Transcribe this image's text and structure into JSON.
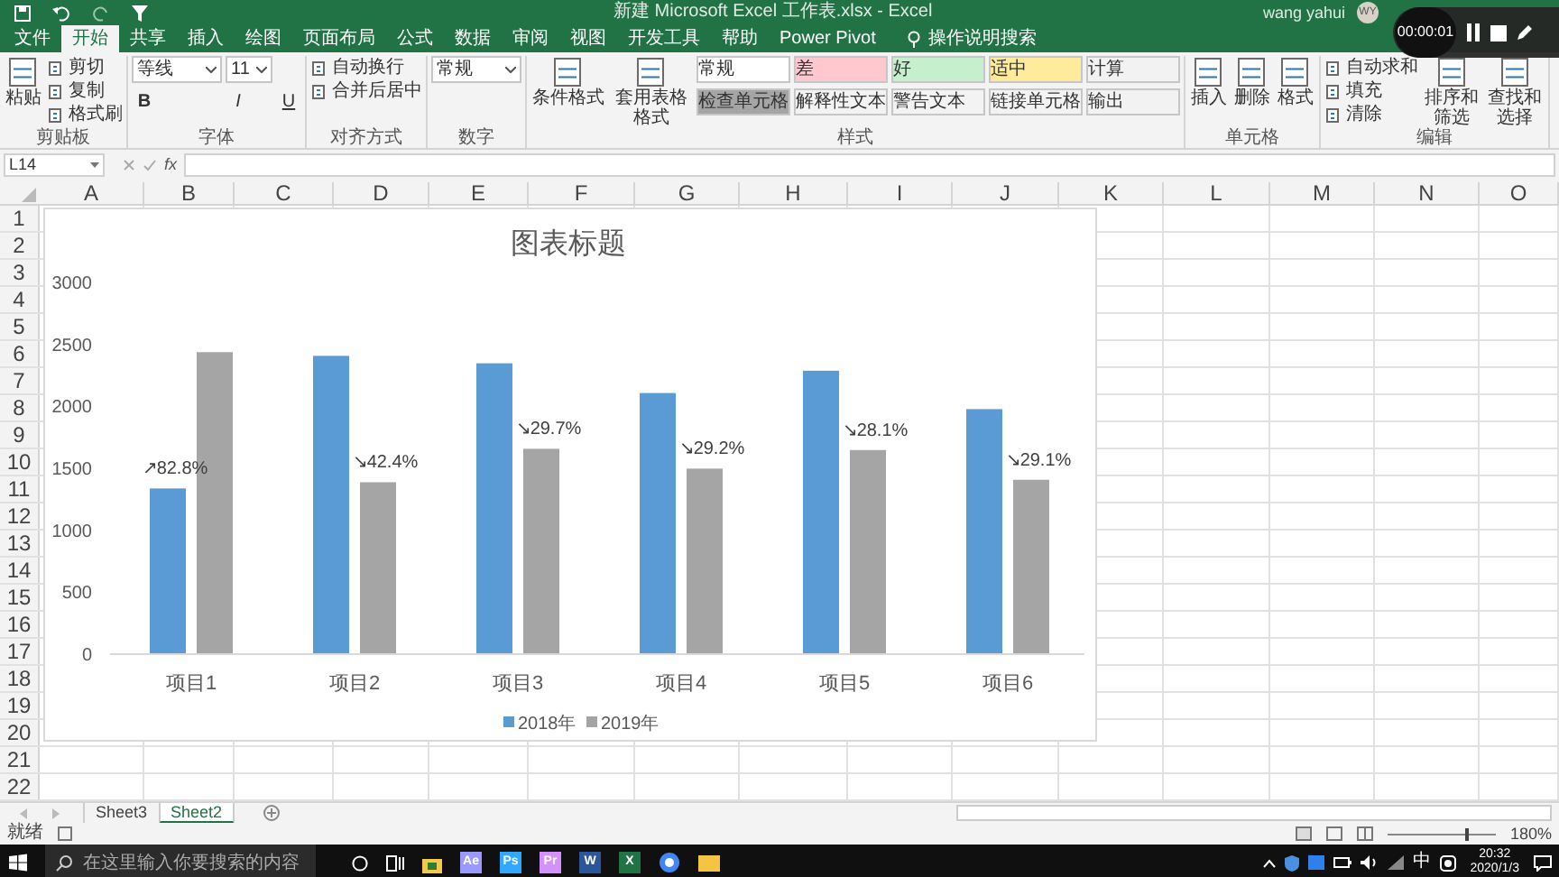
{
  "window": {
    "title": "新建 Microsoft Excel 工作表.xlsx - Excel",
    "user": "wang yahui",
    "avatar": "WY"
  },
  "recorder": {
    "time": "00:00:01"
  },
  "ribbon_tabs": [
    {
      "label": "文件",
      "selected": false
    },
    {
      "label": "开始",
      "selected": true
    },
    {
      "label": "共享",
      "selected": false
    },
    {
      "label": "插入",
      "selected": false
    },
    {
      "label": "绘图",
      "selected": false
    },
    {
      "label": "页面布局",
      "selected": false
    },
    {
      "label": "公式",
      "selected": false
    },
    {
      "label": "数据",
      "selected": false
    },
    {
      "label": "审阅",
      "selected": false
    },
    {
      "label": "视图",
      "selected": false
    },
    {
      "label": "开发工具",
      "selected": false
    },
    {
      "label": "帮助",
      "selected": false
    },
    {
      "label": "Power Pivot",
      "selected": false
    }
  ],
  "tell_me": "操作说明搜索",
  "ribbon_groups": [
    {
      "label": "剪贴板",
      "columns": [
        [
          {
            "kind": "big",
            "label": "粘贴"
          }
        ],
        [
          {
            "kind": "small",
            "label": "剪切"
          },
          {
            "kind": "small",
            "label": "复制"
          },
          {
            "kind": "small",
            "label": "格式刷"
          }
        ]
      ]
    },
    {
      "label": "字体",
      "columns": [
        [
          {
            "kind": "field",
            "value": "等线"
          },
          {
            "kind": "glyph",
            "label": "B"
          }
        ],
        [
          {
            "kind": "spin",
            "value": "11"
          },
          {
            "kind": "glyph",
            "label": "I"
          }
        ],
        [
          {
            "kind": "glyph",
            "label": "U"
          }
        ]
      ]
    },
    {
      "label": "对齐方式",
      "columns": [
        [
          {
            "kind": "small",
            "label": "自动换行"
          },
          {
            "kind": "small",
            "label": "合并后居中"
          }
        ]
      ]
    },
    {
      "label": "数字",
      "columns": [
        [
          {
            "kind": "field",
            "value": "常规"
          }
        ]
      ]
    },
    {
      "label": "样式",
      "columns": [
        [
          {
            "kind": "big",
            "label": "条件格式"
          }
        ],
        [
          {
            "kind": "big",
            "label": "套用表格格式"
          }
        ],
        [
          {
            "kind": "style",
            "label": "常规",
            "color": "#ffffff"
          },
          {
            "kind": "style",
            "label": "检查单元格",
            "color": "#a5a5a5"
          }
        ],
        [
          {
            "kind": "style",
            "label": "差",
            "color": "#ffc7ce"
          },
          {
            "kind": "style",
            "label": "解释性文本",
            "color": "#f3f3f3"
          }
        ],
        [
          {
            "kind": "style",
            "label": "好",
            "color": "#c6efce"
          },
          {
            "kind": "style",
            "label": "警告文本",
            "color": "#f3f3f3"
          }
        ],
        [
          {
            "kind": "style",
            "label": "适中",
            "color": "#ffeb9c"
          },
          {
            "kind": "style",
            "label": "链接单元格",
            "color": "#f3f3f3"
          }
        ],
        [
          {
            "kind": "style",
            "label": "计算",
            "color": "#f2f2f2"
          },
          {
            "kind": "style",
            "label": "输出",
            "color": "#f2f2f2"
          }
        ]
      ]
    },
    {
      "label": "单元格",
      "columns": [
        [
          {
            "kind": "big",
            "label": "插入"
          }
        ],
        [
          {
            "kind": "big",
            "label": "删除"
          }
        ],
        [
          {
            "kind": "big",
            "label": "格式"
          }
        ]
      ]
    },
    {
      "label": "编辑",
      "columns": [
        [
          {
            "kind": "small",
            "label": "自动求和"
          },
          {
            "kind": "small",
            "label": "填充"
          },
          {
            "kind": "small",
            "label": "清除"
          }
        ],
        [
          {
            "kind": "big",
            "label": "排序和筛选"
          }
        ],
        [
          {
            "kind": "big",
            "label": "查找和选择"
          }
        ]
      ]
    }
  ],
  "formula_bar": {
    "name_box": "L14",
    "function_label": "fx"
  },
  "columns": [
    "A",
    "B",
    "C",
    "D",
    "E",
    "F",
    "G",
    "H",
    "I",
    "J",
    "K",
    "L",
    "M",
    "N",
    "O"
  ],
  "rows": [
    "1",
    "2",
    "3",
    "4",
    "5",
    "6",
    "7",
    "8",
    "9",
    "10",
    "11",
    "12",
    "13",
    "14",
    "15",
    "16",
    "17",
    "18",
    "19",
    "20",
    "21",
    "22"
  ],
  "chart": {
    "chart_data": {
      "type": "bar",
      "title": "图表标题",
      "categories": [
        "项目1",
        "项目2",
        "项目3",
        "项目4",
        "项目5",
        "项目6"
      ],
      "series": [
        {
          "name": "2018年",
          "color": "#5b9bd5",
          "values": [
            1330,
            2400,
            2340,
            2100,
            2280,
            1970
          ]
        },
        {
          "name": "2019年",
          "color": "#a5a5a5",
          "values": [
            2430,
            1380,
            1650,
            1490,
            1640,
            1400
          ]
        }
      ],
      "legend": true,
      "ylim": [
        0,
        3000
      ],
      "yticks": [
        0,
        500,
        1000,
        1500,
        2000,
        2500,
        3000
      ],
      "annotations": [
        {
          "text": "↗82.8%"
        },
        {
          "text": "↘42.4%"
        },
        {
          "text": "↘29.7%"
        },
        {
          "text": "↘29.2%"
        },
        {
          "text": "↘28.1%"
        },
        {
          "text": "↘29.1%"
        }
      ]
    }
  },
  "sheet_tabs": [
    {
      "label": "Sheet3",
      "selected": false
    },
    {
      "label": "Sheet2",
      "selected": true
    }
  ],
  "status_bar": {
    "status": "就绪",
    "zoom": "180%",
    "zoom_slider": {
      "level": 0.72
    }
  },
  "taskbar": {
    "search_placeholder": "在这里输入你要搜索的内容",
    "apps": [
      {
        "label": "Ae",
        "color": "#9999ff"
      },
      {
        "label": "Ps",
        "color": "#31a8ff"
      },
      {
        "label": "Pr",
        "color": "#d291ff"
      },
      {
        "label": "W",
        "color": "#2b579a"
      },
      {
        "label": "X",
        "color": "#217346"
      }
    ],
    "ime": "中",
    "time": "20:32",
    "date": "2020/1/3"
  }
}
